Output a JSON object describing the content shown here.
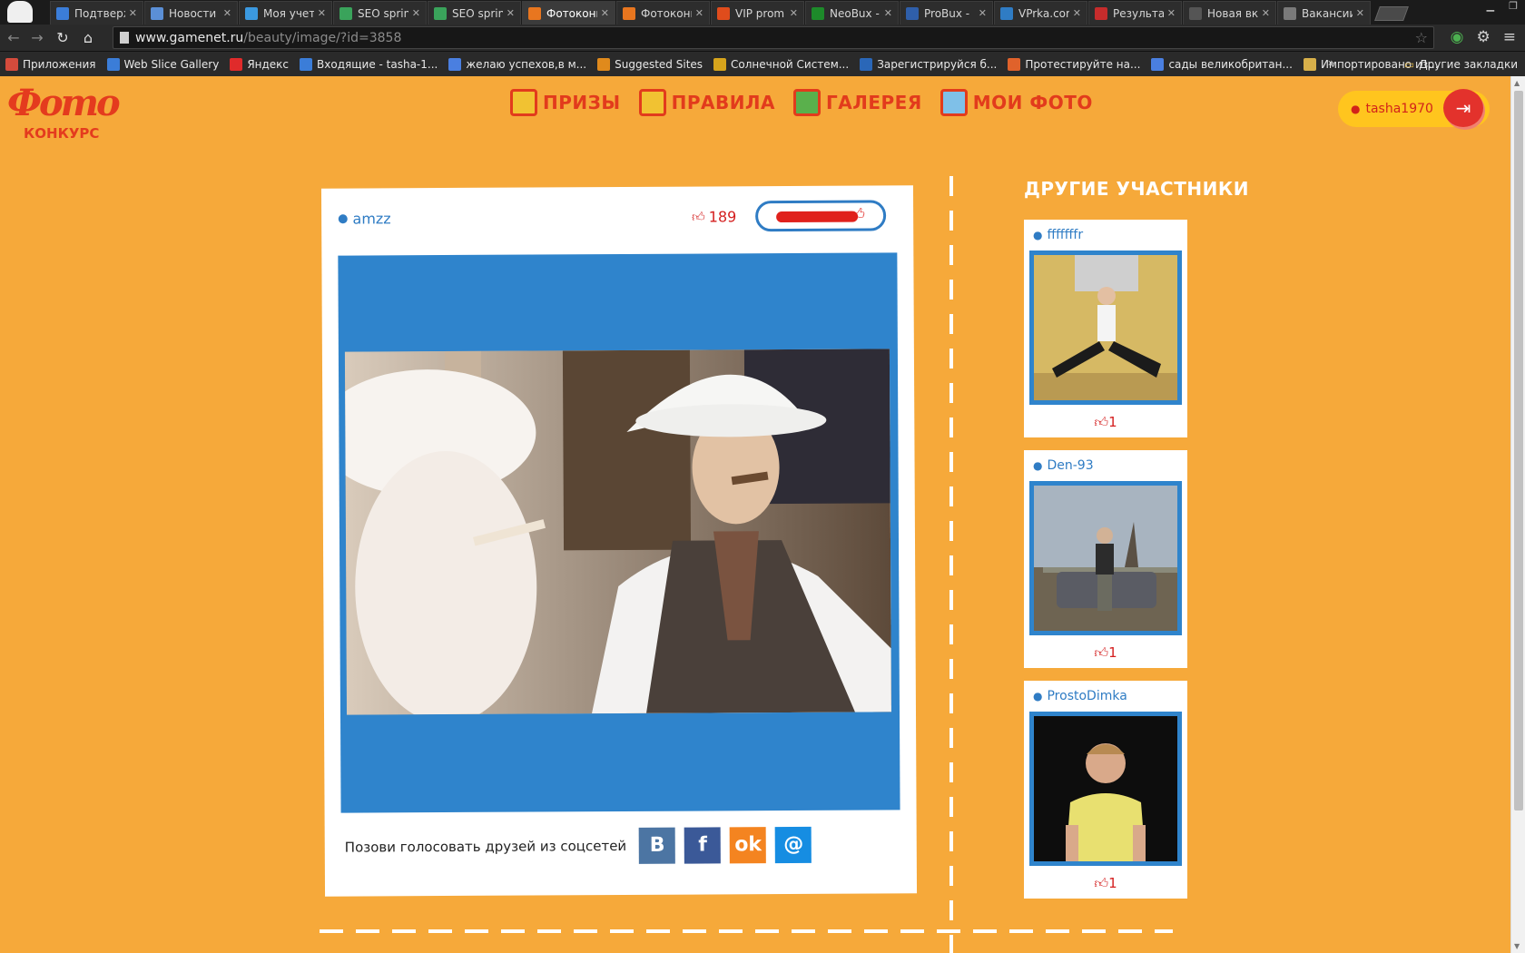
{
  "browser": {
    "tabs": [
      {
        "title": "Подтверж",
        "favicon_color": "#3b7dd8"
      },
      {
        "title": "Новости",
        "favicon_color": "#5b8fd6"
      },
      {
        "title": "Моя учет",
        "favicon_color": "#3b99e0"
      },
      {
        "title": "SEO sprin",
        "favicon_color": "#3aa35b"
      },
      {
        "title": "SEO sprin",
        "favicon_color": "#3aa35b"
      },
      {
        "title": "Фотоконк",
        "favicon_color": "#e8761f",
        "active": true
      },
      {
        "title": "Фотоконк",
        "favicon_color": "#e8761f"
      },
      {
        "title": "VIP prom",
        "favicon_color": "#e04c1c"
      },
      {
        "title": "NeoBux -",
        "favicon_color": "#1d8a2a"
      },
      {
        "title": "ProBux -",
        "favicon_color": "#2f5faa"
      },
      {
        "title": "VPrka.cor",
        "favicon_color": "#2f7cc4"
      },
      {
        "title": "Результа",
        "favicon_color": "#c62c2c"
      },
      {
        "title": "Новая вклад",
        "favicon_color": "#555555"
      },
      {
        "title": "Вакансии",
        "favicon_color": "#7a7a7a"
      }
    ],
    "url_host": "www.gamenet.ru",
    "url_path": "/beauty/image/?id=3858",
    "bookmarks": [
      {
        "label": "Приложения",
        "color": "#d44b3c"
      },
      {
        "label": "Web Slice Gallery",
        "color": "#3b7dd8"
      },
      {
        "label": "Яндекс",
        "color": "#e02b2b"
      },
      {
        "label": "Входящие - tasha-1...",
        "color": "#3b7dd8"
      },
      {
        "label": "желаю успехов,в м...",
        "color": "#4a7fe0"
      },
      {
        "label": "Suggested Sites",
        "color": "#e08a1c"
      },
      {
        "label": "Солнечной Систем...",
        "color": "#d6a41c"
      },
      {
        "label": "Зарегистрируйся б...",
        "color": "#2a67b8"
      },
      {
        "label": "Протестируйте на...",
        "color": "#e0622b"
      },
      {
        "label": "сады великобритан...",
        "color": "#4a7fe0"
      },
      {
        "label": "Импортировано из...",
        "color": "#d8b04a"
      }
    ],
    "bookmarks_more": "»",
    "other_bookmarks": "Другие закладки"
  },
  "site": {
    "logo_main": "Фото",
    "logo_sub": "КОНКУРС",
    "nav": [
      {
        "label": "ПРИЗЫ"
      },
      {
        "label": "ПРАВИЛА"
      },
      {
        "label": "ГАЛЕРЕЯ"
      },
      {
        "label": "МОИ ФОТО"
      }
    ],
    "user": "tasha1970"
  },
  "photo_card": {
    "author": "amzz",
    "votes": "189",
    "share_label": "Позови голосовать друзей из соцсетей",
    "share_buttons": [
      {
        "name": "vk",
        "glyph": "В",
        "color": "#4c75a3"
      },
      {
        "name": "facebook",
        "glyph": "f",
        "color": "#3b5998"
      },
      {
        "name": "odnoklassniki",
        "glyph": "ok",
        "color": "#f48420"
      },
      {
        "name": "mailru",
        "glyph": "@",
        "color": "#168de2"
      }
    ]
  },
  "sidebar": {
    "title": "ДРУГИЕ УЧАСТНИКИ",
    "participants": [
      {
        "name": "fffffffr",
        "votes": "1"
      },
      {
        "name": "Den-93",
        "votes": "1"
      },
      {
        "name": "ProstoDimka",
        "votes": "1"
      }
    ]
  }
}
